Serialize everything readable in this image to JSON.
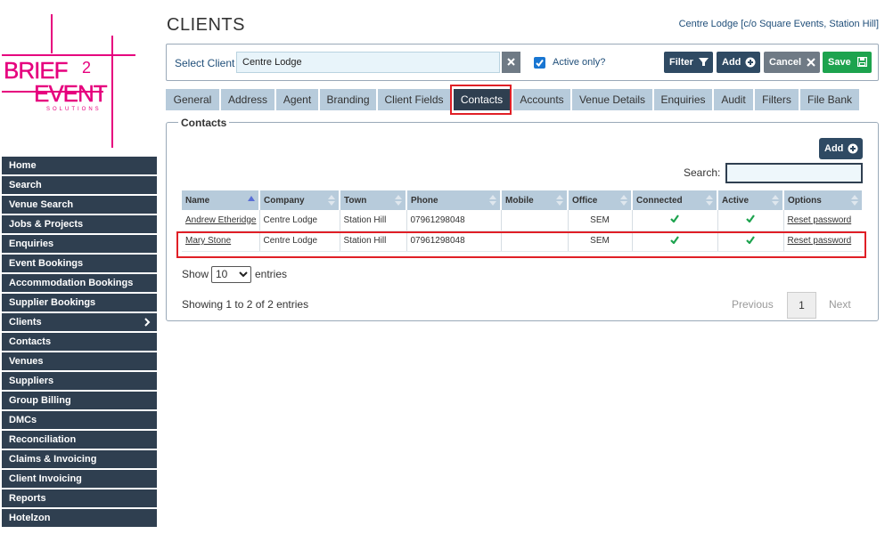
{
  "logo": {
    "line1": "BRIEF",
    "super": "2",
    "line2": "EVENT",
    "tagline": "SOLUTIONS",
    "color": "#e6007e"
  },
  "sidebar": {
    "items": [
      {
        "label": "Home"
      },
      {
        "label": "Search"
      },
      {
        "label": "Venue Search"
      },
      {
        "label": "Jobs & Projects"
      },
      {
        "label": "Enquiries"
      },
      {
        "label": "Event Bookings"
      },
      {
        "label": "Accommodation Bookings"
      },
      {
        "label": "Supplier Bookings"
      },
      {
        "label": "Clients",
        "active": true
      },
      {
        "label": "Contacts"
      },
      {
        "label": "Venues"
      },
      {
        "label": "Suppliers"
      },
      {
        "label": "Group Billing"
      },
      {
        "label": "DMCs"
      },
      {
        "label": "Reconciliation"
      },
      {
        "label": "Claims & Invoicing"
      },
      {
        "label": "Client Invoicing"
      },
      {
        "label": "Reports"
      },
      {
        "label": "Hotelzon"
      }
    ]
  },
  "header": {
    "title": "CLIENTS",
    "client_info": "Centre Lodge [c/o Square Events, Station Hill]"
  },
  "select_bar": {
    "label": "Select Client",
    "client_value": "Centre Lodge",
    "active_only_label": "Active only?",
    "active_only_checked": true,
    "filter_label": "Filter",
    "add_label": "Add",
    "cancel_label": "Cancel",
    "save_label": "Save"
  },
  "tabs": [
    {
      "label": "General"
    },
    {
      "label": "Address"
    },
    {
      "label": "Agent"
    },
    {
      "label": "Branding"
    },
    {
      "label": "Client Fields"
    },
    {
      "label": "Contacts",
      "active": true
    },
    {
      "label": "Accounts"
    },
    {
      "label": "Venue Details"
    },
    {
      "label": "Enquiries"
    },
    {
      "label": "Audit"
    },
    {
      "label": "Filters"
    },
    {
      "label": "File Bank"
    }
  ],
  "contacts": {
    "legend": "Contacts",
    "add_label": "Add",
    "search_label": "Search:",
    "search_value": "",
    "columns": [
      "Name",
      "Company",
      "Town",
      "Phone",
      "Mobile",
      "Office",
      "Connected",
      "Active",
      "Options"
    ],
    "rows": [
      {
        "name": "Andrew Etheridge",
        "company": "Centre Lodge",
        "town": "Station Hill",
        "phone": "07961298048",
        "mobile": "",
        "office": "SEM",
        "connected": true,
        "active": true,
        "option": "Reset password"
      },
      {
        "name": "Mary Stone",
        "company": "Centre Lodge",
        "town": "Station Hill",
        "phone": "07961298048",
        "mobile": "",
        "office": "SEM",
        "connected": true,
        "active": true,
        "option": "Reset password"
      }
    ],
    "show_label": "Show",
    "entries_value": "10",
    "entries_label": "entries",
    "info": "Showing 1 to 2 of 2 entries",
    "prev_label": "Previous",
    "page": "1",
    "next_label": "Next"
  },
  "colors": {
    "sidebar_bg": "#2f3f50",
    "tab_bg": "#b7cbdb",
    "save_green": "#1da34e",
    "highlight_red": "#e01f26",
    "check_green": "#1da34e"
  }
}
